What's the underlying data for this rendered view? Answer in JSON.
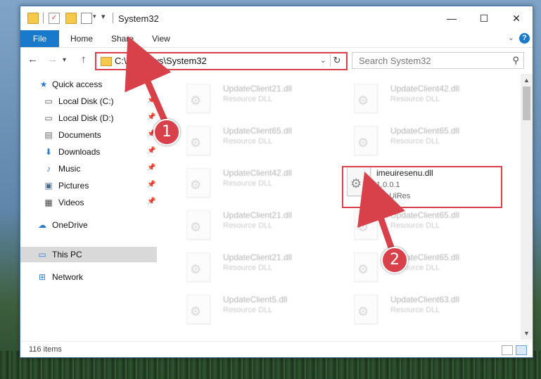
{
  "window": {
    "title": "System32",
    "minimize": "—",
    "maximize": "☐",
    "close": "✕"
  },
  "ribbon": {
    "file": "File",
    "home": "Home",
    "share": "Share",
    "view": "View",
    "help": "?"
  },
  "address": {
    "path": "C:\\Windows\\System32",
    "search_placeholder": "Search System32"
  },
  "sidebar": {
    "items": [
      {
        "label": "Quick access",
        "icon": "star-icon"
      },
      {
        "label": "Local Disk (C:)",
        "icon": "drive-icon"
      },
      {
        "label": "Local Disk (D:)",
        "icon": "drive-icon"
      },
      {
        "label": "Documents",
        "icon": "documents-icon"
      },
      {
        "label": "Downloads",
        "icon": "download-icon"
      },
      {
        "label": "Music",
        "icon": "music-icon"
      },
      {
        "label": "Pictures",
        "icon": "pictures-icon"
      },
      {
        "label": "Videos",
        "icon": "videos-icon"
      },
      {
        "label": "OneDrive",
        "icon": "cloud-icon"
      },
      {
        "label": "This PC",
        "icon": "computer-icon"
      },
      {
        "label": "Network",
        "icon": "network-icon"
      }
    ]
  },
  "files": {
    "left": [
      {
        "name": "UpdateClient21.dll",
        "type": "Resource DLL"
      },
      {
        "name": "UpdateClient65.dll",
        "type": "Resource DLL"
      },
      {
        "name": "UpdateClient42.dll",
        "type": "Resource DLL"
      },
      {
        "name": "UpdateClient21.dll",
        "type": "Resource DLL"
      },
      {
        "name": "UpdateClient21.dll",
        "type": "Resource DLL"
      },
      {
        "name": "UpdateClient5.dll",
        "type": "Resource DLL"
      }
    ],
    "right": [
      {
        "name": "UpdateClient42.dll",
        "type": "Resource DLL"
      },
      {
        "name": "UpdateClient65.dll",
        "type": "Resource DLL"
      },
      {
        "name": "UpdateClient65.dll",
        "type": "Resource DLL"
      },
      {
        "name": "UpdateClient65.dll",
        "type": "Resource DLL"
      },
      {
        "name": "UpdateClient63.dll",
        "type": "Resource DLL"
      }
    ],
    "target": {
      "name": "imeuiresenu.dll",
      "version": "1.0.0.1",
      "description": "ImeUiRes"
    }
  },
  "status": {
    "item_count": "116 items"
  },
  "annotations": {
    "step1": "1",
    "step2": "2"
  },
  "colors": {
    "accent": "#1979ca",
    "annotation": "#d9414a"
  }
}
